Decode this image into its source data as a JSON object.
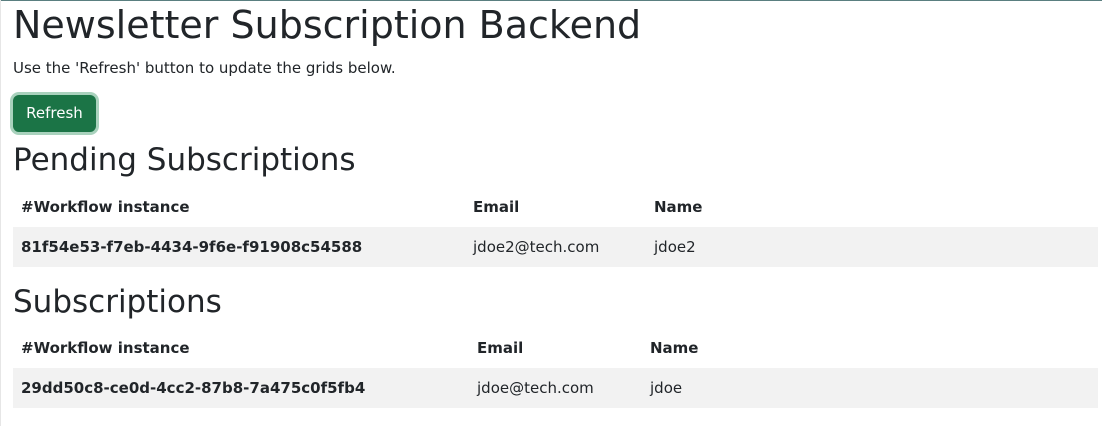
{
  "header": {
    "title": "Newsletter Subscription Backend",
    "intro": "Use the 'Refresh' button to update the grids below."
  },
  "toolbar": {
    "refresh_label": "Refresh"
  },
  "colors": {
    "primary_button": "#1b7446",
    "button_focus_ring": "#a9d2bd",
    "row_background": "#f2f2f2",
    "text": "#212529"
  },
  "pending": {
    "title": "Pending Subscriptions",
    "columns": [
      "#Workflow instance",
      "Email",
      "Name"
    ],
    "rows": [
      {
        "workflow_instance": "81f54e53-f7eb-4434-9f6e-f91908c54588",
        "email": "jdoe2@tech.com",
        "name": "jdoe2"
      }
    ]
  },
  "subscriptions": {
    "title": "Subscriptions",
    "columns": [
      "#Workflow instance",
      "Email",
      "Name"
    ],
    "rows": [
      {
        "workflow_instance": "29dd50c8-ce0d-4cc2-87b8-7a475c0f5fb4",
        "email": "jdoe@tech.com",
        "name": "jdoe"
      }
    ]
  }
}
